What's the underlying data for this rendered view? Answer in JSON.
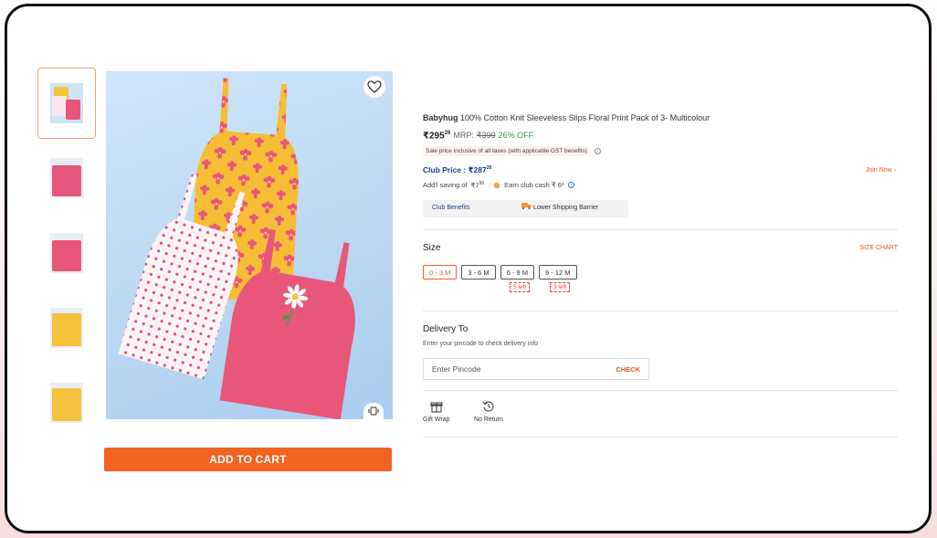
{
  "product": {
    "brand": "Babyhug",
    "title": "100% Cotton Knit Sleeveless Slips Floral Print Pack of 3- Multicolour",
    "price_main": "₹295",
    "price_sup": "26",
    "mrp_label": "MRP:",
    "mrp_value": "₹399",
    "discount": "26% OFF",
    "tax_note": "Sale price inclusive of all taxes (with applicable GST benefits)"
  },
  "club": {
    "label": "Club Price :",
    "price_main": "₹287",
    "price_sup": "28",
    "join": "Join Now",
    "saving_prefix": "Add'l saving of",
    "saving_main": "₹7",
    "saving_sup": "98",
    "earn": "Earn club cash ₹ 6*",
    "benefits": "Club Benefits",
    "shipping": "Lower Shipping Barrier"
  },
  "size": {
    "label": "Size",
    "chart": "SIZE CHART",
    "options": [
      "0 - 3 M",
      "3 - 6 M",
      "6 - 9 M",
      "9 - 12 M"
    ],
    "selected": "0 - 3 M",
    "stock_tags": [
      "5 left",
      "3 left"
    ]
  },
  "delivery": {
    "label": "Delivery To",
    "sub": "Enter your pincode to check delivery info",
    "placeholder": "Enter Pincode",
    "check": "CHECK"
  },
  "features": {
    "gift_wrap": "Gift Wrap",
    "no_return": "No Return"
  },
  "cart": {
    "label": "ADD TO CART"
  },
  "colors": {
    "accent": "#f26322",
    "club_blue": "#1c3f8a",
    "discount_green": "#2e9a48",
    "stock_red": "#e8402a"
  },
  "icons": [
    "heart-icon",
    "view-360-icon",
    "info-icon",
    "chevron-right-icon",
    "truck-icon",
    "gift-icon",
    "no-return-icon"
  ]
}
